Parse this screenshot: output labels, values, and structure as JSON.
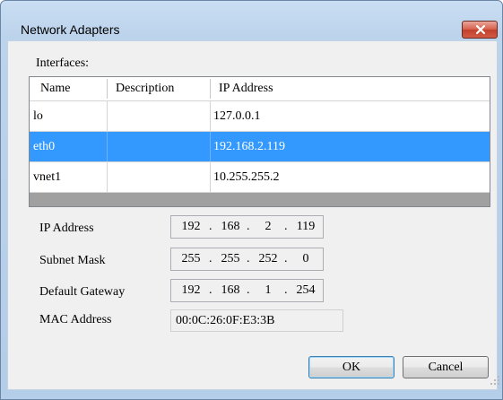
{
  "window": {
    "title": "Network Adapters"
  },
  "interfaces": {
    "label": "Interfaces:",
    "columns": [
      "Name",
      "Description",
      "IP Address"
    ],
    "rows": [
      {
        "name": "lo",
        "description": "",
        "ip": "127.0.0.1",
        "selected": false
      },
      {
        "name": "eth0",
        "description": "",
        "ip": "192.168.2.119",
        "selected": true
      },
      {
        "name": "vnet1",
        "description": "",
        "ip": "10.255.255.2",
        "selected": false
      }
    ]
  },
  "details": {
    "ip_label": "IP Address",
    "ip": [
      "192",
      "168",
      "2",
      "119"
    ],
    "subnet_label": "Subnet Mask",
    "subnet": [
      "255",
      "255",
      "252",
      "0"
    ],
    "gateway_label": "Default Gateway",
    "gateway": [
      "192",
      "168",
      "1",
      "254"
    ],
    "mac_label": "MAC Address",
    "mac": "00:0C:26:0F:E3:3B"
  },
  "buttons": {
    "ok": "OK",
    "cancel": "Cancel"
  },
  "colors": {
    "selection": "#3399ff",
    "close_button": "#c7432e",
    "title_bar": "#bcd3ec"
  },
  "icons": {
    "close": "close-icon",
    "resize": "resize-grip-icon"
  }
}
